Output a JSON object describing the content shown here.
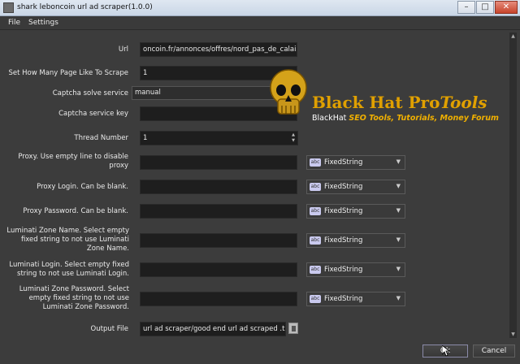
{
  "window": {
    "title": "shark leboncoin url ad scraper(1.0.0)"
  },
  "menu": [
    "File",
    "Settings"
  ],
  "form": {
    "url": {
      "label": "Url",
      "value": "oncoin.fr/annonces/offres/nord_pas_de_calais/"
    },
    "pages": {
      "label": "Set How Many Page Like To Scrape",
      "value": "1"
    },
    "captcha_service": {
      "label": "Captcha solve service",
      "value": "manual"
    },
    "captcha_key": {
      "label": "Captcha service key",
      "value": ""
    },
    "threads": {
      "label": "Thread Number",
      "value": "1"
    },
    "proxy": {
      "label": "Proxy. Use empty line to disable proxy",
      "type": "FixedString"
    },
    "proxy_login": {
      "label": "Proxy Login. Can be blank.",
      "type": "FixedString"
    },
    "proxy_password": {
      "label": "Proxy Password. Can be blank.",
      "type": "FixedString"
    },
    "luminati_zone": {
      "label": "Luminati Zone Name. Select empty fixed string to not use Luminati Zone Name.",
      "type": "FixedString"
    },
    "luminati_login": {
      "label": "Luminati Login. Select empty fixed string to not use Luminati Login.",
      "type": "FixedString"
    },
    "luminati_password": {
      "label": "Luminati Zone Password. Select empty fixed string to not use Luminati Zone Password.",
      "type": "FixedString"
    },
    "output_file": {
      "label": "Output File",
      "value": "url ad scraper/good end url ad scraped .txt"
    }
  },
  "buttons": {
    "ok": "Ok",
    "cancel": "Cancel"
  },
  "watermark": {
    "brand": "Black Hat Pro",
    "brand_tools": "Tools",
    "sub_plain": "BlackHat ",
    "sub_em": "SEO Tools, Tutorials, Money Forum"
  },
  "icons": {
    "type_badge": "abc",
    "dropdown": "chevron-down-icon",
    "app": "app-icon",
    "folder": "folder-icon",
    "close": "close-icon"
  },
  "colors": {
    "accent": "#e0a000",
    "background": "#3c3c3c",
    "field": "#1e1e1e"
  }
}
